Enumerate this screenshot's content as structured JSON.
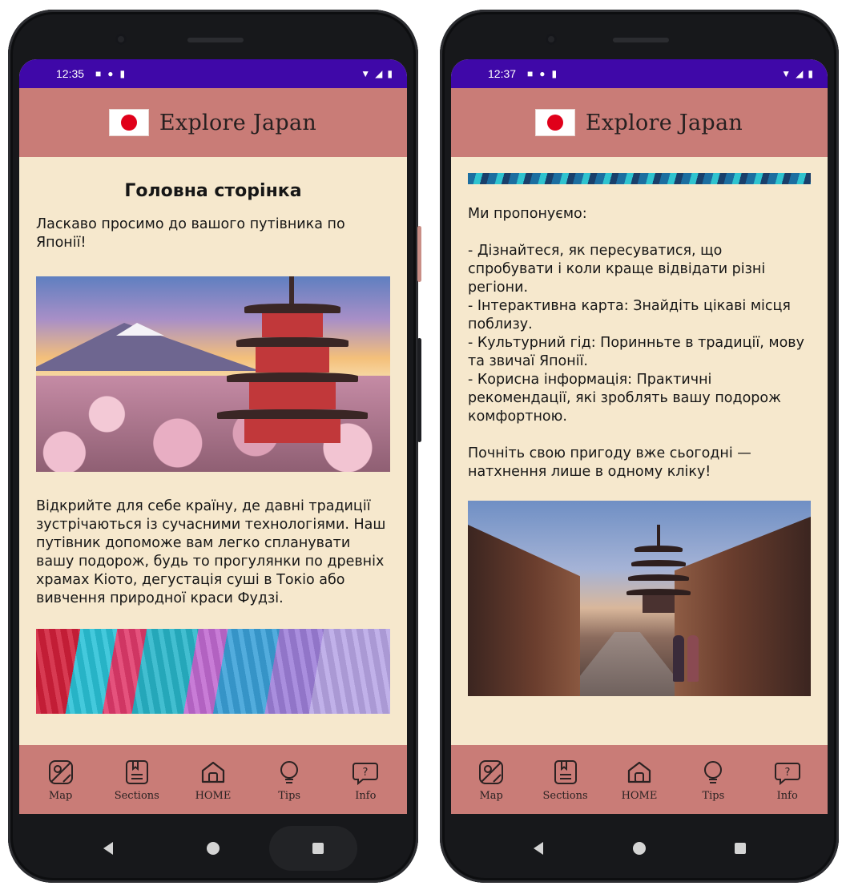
{
  "phones": [
    {
      "status": {
        "time": "12:35"
      },
      "header": {
        "title": "Explore Japan"
      },
      "content": {
        "heading": "Головна сторінка",
        "intro": "Ласкаво просимо до вашого путівника по Японії!",
        "body": "Відкрийте для себе країну, де давні традиції зустрічаються із сучасними технологіями. Наш путівник допоможе вам легко спланувати вашу подорож, будь то прогулянки по древніх храмах Кіото, дегустація суші в Токіо або вивчення природної краси Фудзі."
      },
      "nav": [
        "Map",
        "Sections",
        "HOME",
        "Tips",
        "Info"
      ]
    },
    {
      "status": {
        "time": "12:37"
      },
      "header": {
        "title": "Explore Japan"
      },
      "content": {
        "offer": "Ми пропонуємо:\n\n- Дізнайтеся, як пересуватися, що спробувати і коли краще відвідати різні регіони.\n- Інтерактивна карта: Знайдіть цікаві місця поблизу.\n- Культурний гід: Поринньте в традиції, мову та звичаї Японії.\n- Корисна інформація: Практичні рекомендації, які зроблять вашу подорож комфортною.\n\nПочніть свою пригоду вже сьогодні — натхнення лише в одному кліку!"
      },
      "nav": [
        "Map",
        "Sections",
        "HOME",
        "Tips",
        "Info"
      ]
    }
  ],
  "theme": {
    "status_bar": "#3f08a8",
    "header_bg": "#c97c77",
    "page_bg": "#f6e8cd",
    "flag_red": "#e0001a"
  },
  "icons": {
    "nav": [
      "map-icon",
      "sections-icon",
      "home-icon",
      "tips-icon",
      "info-icon"
    ],
    "system": [
      "back-icon",
      "home-circle-icon",
      "recents-icon"
    ]
  }
}
